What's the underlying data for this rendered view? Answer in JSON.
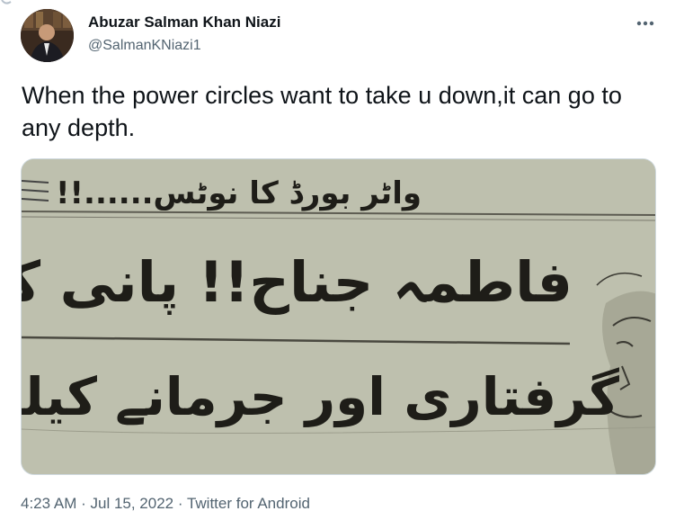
{
  "tweet": {
    "author_name": "Abuzar Salman Khan Niazi",
    "author_handle": "@SalmanKNiazi1",
    "text": "When the power circles want to take u down,it can go to any depth.",
    "more_icon": "more-horizontal-icon",
    "media": {
      "line1": "واٹر بورڈ کا نوٹس......!!",
      "line2": "فاطمہ جناح!! پانی کا بل دیں",
      "line3": "گرفتاری اور جرمانے کیلئے تیار ہو جا"
    },
    "time": "4:23 AM",
    "date": "Jul 15, 2022",
    "source": "Twitter for Android",
    "separator": " · "
  },
  "colors": {
    "text_primary": "#0f1419",
    "text_secondary": "#536471",
    "border": "#cfd9de",
    "newspaper": "#b9bba9"
  }
}
